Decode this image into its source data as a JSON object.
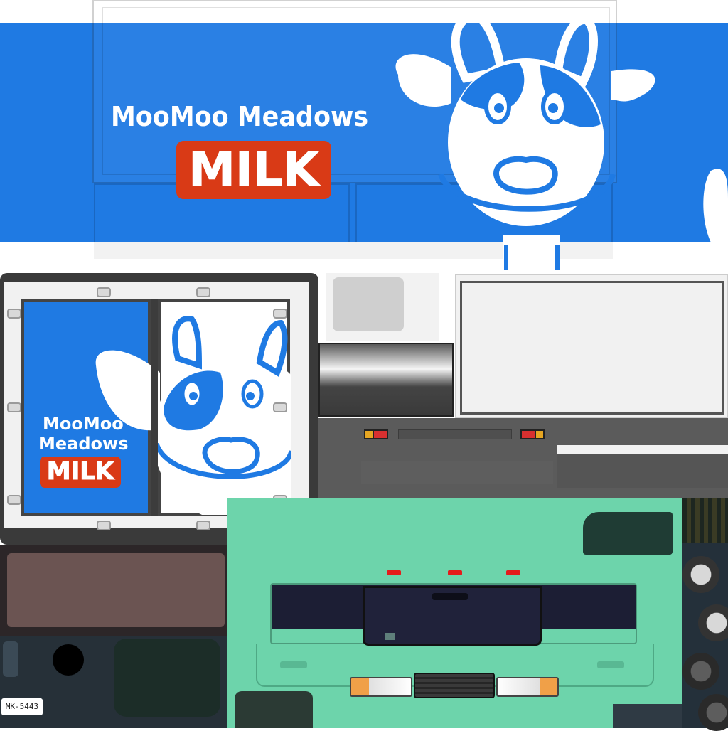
{
  "side_panel": {
    "brand_line": "MooMoo  Meadows",
    "product": "MILK"
  },
  "rear_door": {
    "brand_line_1": "MooMoo",
    "brand_line_2": "Meadows",
    "product": "MILK"
  },
  "license_plate": "MK-5443",
  "colors": {
    "brand_blue": "#1f7ae3",
    "milk_red": "#d93a16",
    "cab_mint": "#6dd4ab",
    "dark_window": "#1c1e34"
  }
}
